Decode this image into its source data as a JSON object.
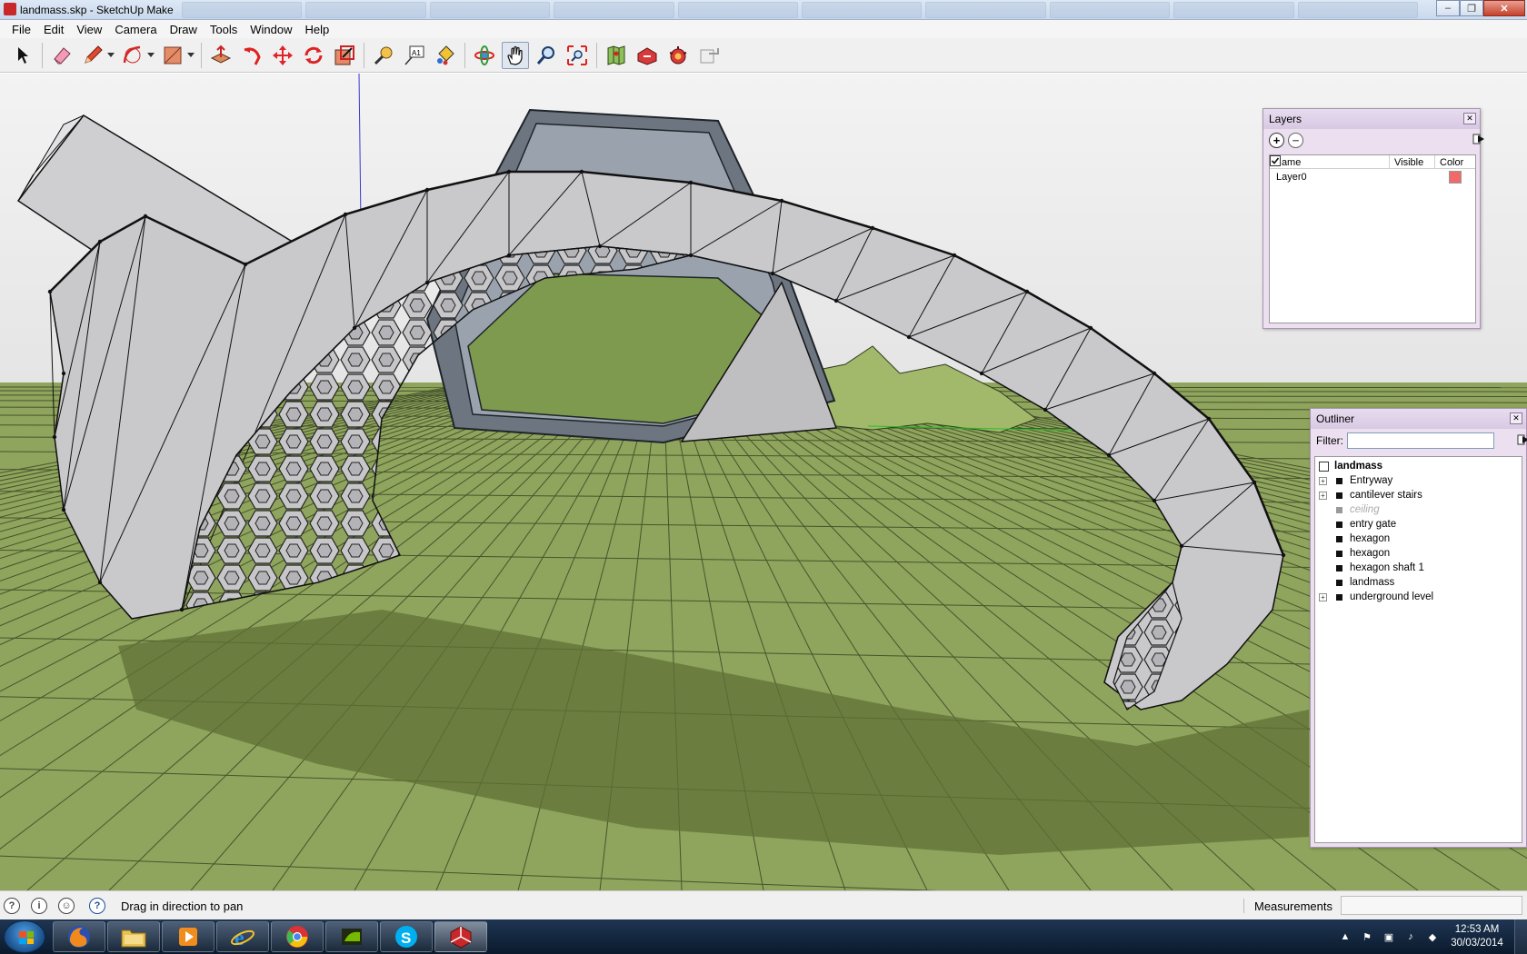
{
  "window": {
    "title": "landmass.skp - SketchUp Make"
  },
  "menu": [
    "File",
    "Edit",
    "View",
    "Camera",
    "Draw",
    "Tools",
    "Window",
    "Help"
  ],
  "layers": {
    "title": "Layers",
    "columns": [
      "Name",
      "Visible",
      "Color"
    ],
    "rows": [
      {
        "name": "Layer0",
        "visible": true,
        "color": "#f06a6a"
      }
    ]
  },
  "outliner": {
    "title": "Outliner",
    "filter_label": "Filter:",
    "filter_value": "",
    "root": "landmass",
    "items": [
      {
        "label": "Entryway",
        "expandable": true,
        "hidden": false
      },
      {
        "label": "cantilever stairs",
        "expandable": true,
        "hidden": false
      },
      {
        "label": "ceiling",
        "expandable": false,
        "hidden": true
      },
      {
        "label": "entry gate",
        "expandable": false,
        "hidden": false
      },
      {
        "label": "hexagon",
        "expandable": false,
        "hidden": false
      },
      {
        "label": "hexagon",
        "expandable": false,
        "hidden": false
      },
      {
        "label": "hexagon shaft 1",
        "expandable": false,
        "hidden": false
      },
      {
        "label": "landmass",
        "expandable": false,
        "hidden": false
      },
      {
        "label": "underground level",
        "expandable": true,
        "hidden": false
      }
    ]
  },
  "status": {
    "message": "Drag in direction to pan",
    "measurements_label": "Measurements",
    "measurements_value": ""
  },
  "taskbar": {
    "apps": [
      "firefox",
      "explorer",
      "media-player",
      "internet-explorer",
      "chrome",
      "nvidia",
      "skype",
      "sketchup"
    ],
    "active": "sketchup",
    "time": "12:53 AM",
    "date": "30/03/2014"
  },
  "colors": {
    "ground": "#8ea35a",
    "model": "#c9c9cc",
    "sky": "#e9e9e9",
    "accent": "#c8282a"
  }
}
